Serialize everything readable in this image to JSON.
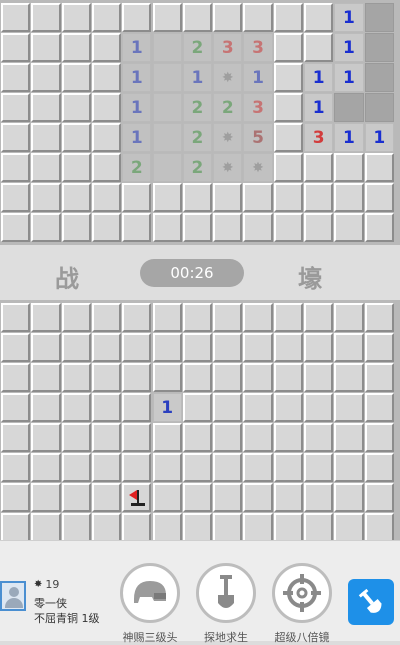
{
  "colors": {
    "one": "#2a3fbf",
    "one_bright": "#1a2fd0",
    "two": "#4a9a4a",
    "three": "#d23c3c",
    "five": "#a03a3a"
  },
  "top_board": {
    "cells": [
      {
        "row": 0,
        "col": 11,
        "state": "open",
        "value": "1",
        "tone": "one_bright"
      },
      {
        "row": 1,
        "col": 4,
        "state": "open",
        "value": "1",
        "tone": "one",
        "faded": true
      },
      {
        "row": 1,
        "col": 6,
        "state": "open",
        "value": "2",
        "tone": "two",
        "faded": true
      },
      {
        "row": 1,
        "col": 7,
        "state": "open",
        "value": "3",
        "tone": "three",
        "faded": true
      },
      {
        "row": 1,
        "col": 8,
        "state": "open",
        "value": "3",
        "tone": "three",
        "faded": true
      },
      {
        "row": 1,
        "col": 11,
        "state": "open",
        "value": "1",
        "tone": "one_bright"
      },
      {
        "row": 2,
        "col": 4,
        "state": "open",
        "value": "1",
        "tone": "one",
        "faded": true
      },
      {
        "row": 2,
        "col": 6,
        "state": "open",
        "value": "1",
        "tone": "one",
        "faded": true
      },
      {
        "row": 2,
        "col": 7,
        "state": "open",
        "value": "mine",
        "faded": true
      },
      {
        "row": 2,
        "col": 8,
        "state": "open",
        "value": "1",
        "tone": "one",
        "faded": true
      },
      {
        "row": 2,
        "col": 10,
        "state": "open",
        "value": "1",
        "tone": "one_bright"
      },
      {
        "row": 2,
        "col": 11,
        "state": "open",
        "value": "1",
        "tone": "one_bright"
      },
      {
        "row": 3,
        "col": 4,
        "state": "open",
        "value": "1",
        "tone": "one",
        "faded": true
      },
      {
        "row": 3,
        "col": 6,
        "state": "open",
        "value": "2",
        "tone": "two",
        "faded": true
      },
      {
        "row": 3,
        "col": 7,
        "state": "open",
        "value": "2",
        "tone": "two",
        "faded": true
      },
      {
        "row": 3,
        "col": 8,
        "state": "open",
        "value": "3",
        "tone": "three",
        "faded": true
      },
      {
        "row": 3,
        "col": 10,
        "state": "open",
        "value": "1",
        "tone": "one_bright"
      },
      {
        "row": 4,
        "col": 4,
        "state": "open",
        "value": "1",
        "tone": "one",
        "faded": true
      },
      {
        "row": 4,
        "col": 6,
        "state": "open",
        "value": "2",
        "tone": "two",
        "faded": true
      },
      {
        "row": 4,
        "col": 7,
        "state": "open",
        "value": "mine",
        "faded": true
      },
      {
        "row": 4,
        "col": 8,
        "state": "open",
        "value": "5",
        "tone": "five",
        "faded": true
      },
      {
        "row": 4,
        "col": 10,
        "state": "open",
        "value": "3",
        "tone": "three"
      },
      {
        "row": 4,
        "col": 11,
        "state": "open",
        "value": "1",
        "tone": "one_bright"
      },
      {
        "row": 4,
        "col": 12,
        "state": "open",
        "value": "1",
        "tone": "one_bright"
      },
      {
        "row": 5,
        "col": 4,
        "state": "open",
        "value": "2",
        "tone": "two",
        "faded": true
      },
      {
        "row": 5,
        "col": 6,
        "state": "open",
        "value": "2",
        "tone": "two",
        "faded": true
      },
      {
        "row": 5,
        "col": 7,
        "state": "open",
        "value": "mine",
        "faded": true
      },
      {
        "row": 5,
        "col": 8,
        "state": "open",
        "value": "mine",
        "faded": true
      }
    ],
    "empty_open_faded": [
      [
        1,
        5
      ],
      [
        2,
        5
      ],
      [
        3,
        5
      ],
      [
        4,
        5
      ],
      [
        5,
        5
      ]
    ],
    "empty_open_dark": [
      [
        0,
        12
      ],
      [
        1,
        12
      ],
      [
        2,
        12
      ],
      [
        3,
        11
      ],
      [
        3,
        12
      ],
      [
        0,
        11
      ]
    ]
  },
  "divider": {
    "left_label": "战",
    "right_label": "壕",
    "timer": "00:26"
  },
  "bottom_board": {
    "cells": [
      {
        "row": 3,
        "col": 5,
        "state": "open",
        "value": "1",
        "tone": "one"
      },
      {
        "row": 6,
        "col": 4,
        "state": "flag"
      }
    ]
  },
  "player": {
    "mines_icon": "mine-icon",
    "mines_count": "19",
    "name": "零一侠",
    "rank": "不屈青铜 1级"
  },
  "tools": [
    {
      "icon": "helmet-icon",
      "label": "神赐三级头"
    },
    {
      "icon": "shovel-icon",
      "label": "探地求生"
    },
    {
      "icon": "crosshair-icon",
      "label": "超级八倍镜"
    }
  ],
  "action_icon": "shovel-icon"
}
